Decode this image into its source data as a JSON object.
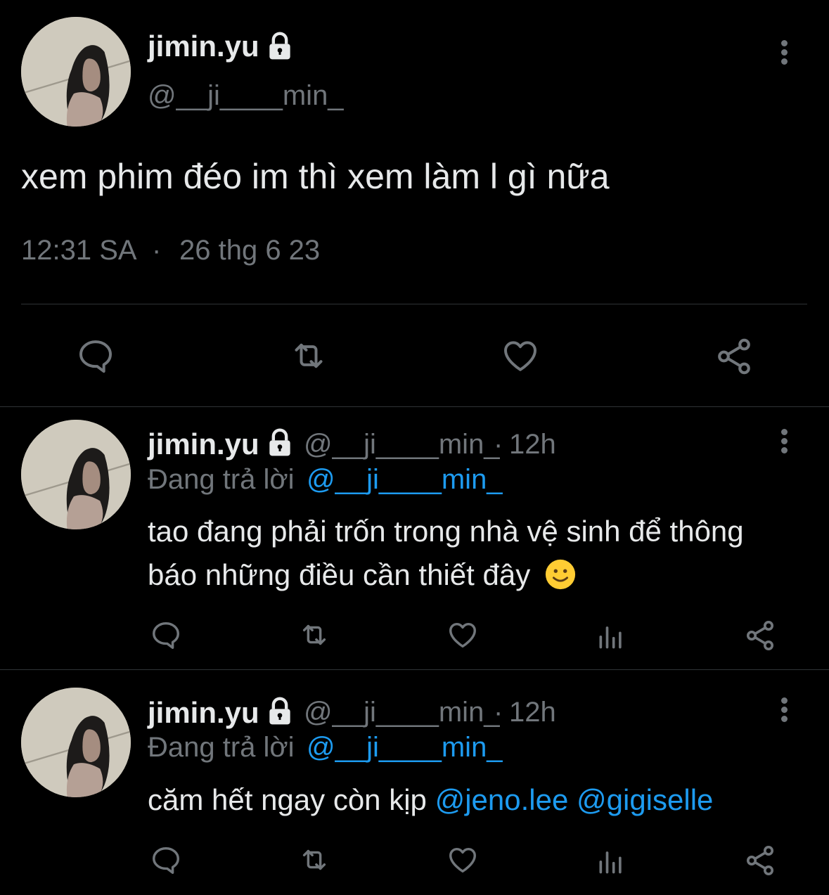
{
  "main_tweet": {
    "display_name": "jimin.yu",
    "handle": "@__ji____min_",
    "text": "xem phim đéo im thì xem làm l gì nữa",
    "time": "12:31 SA",
    "separator": "·",
    "date": "26 thg 6 23"
  },
  "replies": [
    {
      "display_name": "jimin.yu",
      "handle": "@__ji____min_",
      "dot": "·",
      "age": "12h",
      "replying_prefix": "Đang trả lời",
      "replying_to": "@__ji____min_",
      "text_line1": "tao đang phải trốn trong nhà vệ sinh để thông",
      "text_line2": "báo những điều cần thiết đây",
      "emoji": "🙂"
    },
    {
      "display_name": "jimin.yu",
      "handle": "@__ji____min_",
      "dot": "·",
      "age": "12h",
      "replying_prefix": "Đang trả lời",
      "replying_to": "@__ji____min_",
      "text_plain": "căm hết ngay còn kịp",
      "mention1": "@jeno.lee",
      "mention2": "@gigiselle"
    }
  ],
  "icons": {
    "lock": "lock-icon",
    "reply": "reply-icon",
    "retweet": "retweet-icon",
    "like": "heart-icon",
    "views": "views-icon",
    "share": "share-icon",
    "more": "more-vertical-icon"
  },
  "colors": {
    "background": "#000000",
    "text": "#e7e9ea",
    "muted": "#71767b",
    "link": "#1d9bf0",
    "divider": "#2f3336"
  }
}
